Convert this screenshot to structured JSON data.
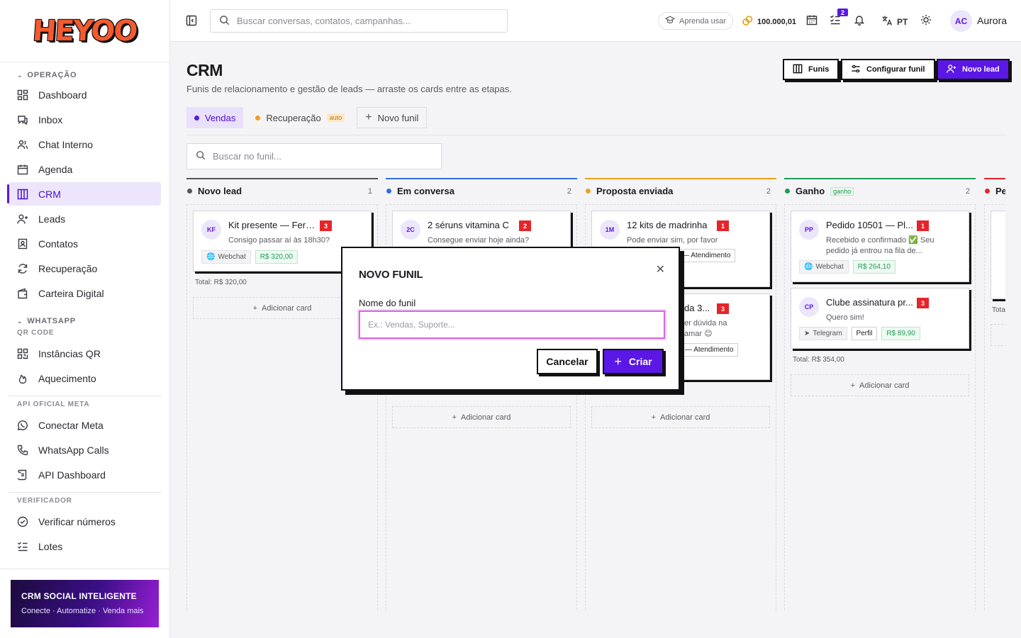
{
  "app": {
    "logo": "HEYOO"
  },
  "sidebar": {
    "sections": {
      "operacao": "OPERAÇÃO",
      "whatsapp": "WHATSAPP",
      "qrcode": "QR CODE",
      "api_meta": "API OFICIAL META",
      "verificador": "VERIFICADOR"
    },
    "items": {
      "dashboard": "Dashboard",
      "inbox": "Inbox",
      "chat_interno": "Chat Interno",
      "agenda": "Agenda",
      "crm": "CRM",
      "leads": "Leads",
      "contatos": "Contatos",
      "recuperacao": "Recuperação",
      "carteira": "Carteira Digital",
      "instancias": "Instâncias QR",
      "aquecimento": "Aquecimento",
      "conectar_meta": "Conectar Meta",
      "whatsapp_calls": "WhatsApp Calls",
      "api_dashboard": "API Dashboard",
      "verificar": "Verificar números",
      "lotes": "Lotes"
    },
    "active": "crm",
    "promo": {
      "title": "CRM SOCIAL INTELIGENTE",
      "subtitle": "Conecte · Automatize · Venda mais"
    }
  },
  "topbar": {
    "search_placeholder": "Buscar conversas, contatos, campanhas...",
    "learn": "Aprenda usar",
    "credits": "100.000,01",
    "tasks_badge": "2",
    "lang": "PT",
    "avatar": "AC",
    "user": "Aurora"
  },
  "page": {
    "title": "CRM",
    "subtitle": "Funis de relacionamento e gestão de leads — arraste os cards entre as etapas.",
    "buttons": {
      "funis": "Funis",
      "configurar": "Configurar funil",
      "novo_lead": "Novo lead"
    },
    "tabs": [
      {
        "label": "Vendas"
      },
      {
        "label": "Recuperação",
        "tag": "auto"
      },
      {
        "label": "Novo funil"
      }
    ],
    "funnel_search_placeholder": "Buscar no funil..."
  },
  "board": {
    "add_card": "Adicionar card",
    "columns": [
      {
        "name": "Novo lead",
        "count": "1",
        "color": "#555555",
        "total": "Total: R$ 320,00",
        "cards": [
          {
            "avatar": "KF",
            "title": "Kit presente — Fern...",
            "num": "3",
            "msg": "Consigo passar aí às 18h30?",
            "channel": "Webchat",
            "value": "R$ 320,00"
          }
        ]
      },
      {
        "name": "Em conversa",
        "count": "2",
        "color": "#2f6ee6",
        "cards": [
          {
            "avatar": "2C",
            "title": "2 séruns vitamina C",
            "num": "2",
            "msg": "Consegue enviar hoje ainda?"
          }
        ]
      },
      {
        "name": "Proposta enviada",
        "count": "2",
        "color": "#f0a020",
        "cards": [
          {
            "avatar": "1M",
            "title": "12 kits de madrinha",
            "num": "1",
            "msg": "Pode enviar sim, por favor",
            "tag": "— Atendimento"
          },
          {
            "title_partial": "da 3...",
            "num": "3",
            "msg_partial_1": "er dúvida na",
            "msg_partial_2": "amar 😊",
            "tag": "— Atendimento"
          }
        ]
      },
      {
        "name": "Ganho",
        "count": "2",
        "color": "#1f9d55",
        "tag": "ganho",
        "total": "Total: R$ 354,00",
        "cards": [
          {
            "avatar": "PP",
            "title": "Pedido 10501 — Pl...",
            "num": "1",
            "msg": "Recebido e confirmado ✅ Seu pedido já entrou na fila de...",
            "channel": "Webchat",
            "value": "R$ 264,10"
          },
          {
            "avatar": "CP",
            "title": "Clube assinatura pr...",
            "num": "3",
            "msg": "Quero sim!",
            "channel": "Telegram",
            "extra": "Perfil",
            "value": "R$ 89,90"
          }
        ]
      },
      {
        "name": "Pe",
        "color": "#e5252a",
        "total_partial": "Tota"
      }
    ]
  },
  "modal": {
    "title": "NOVO FUNIL",
    "label": "Nome do funil",
    "placeholder": "Ex.: Vendas, Suporte...",
    "cancel": "Cancelar",
    "create": "Criar"
  }
}
